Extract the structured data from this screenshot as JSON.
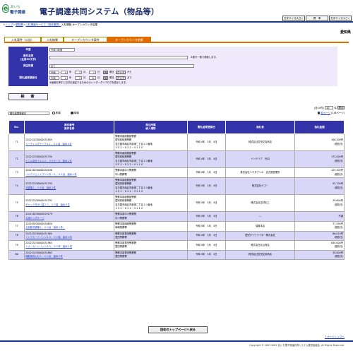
{
  "header": {
    "logo_top": "あいち",
    "logo_bottom": "電子調達",
    "title": "電子調達共同システム（物品等）",
    "buttons": [
      "文字サイズ大きく",
      "標　準",
      "文字サイズ小さく"
    ]
  },
  "breadcrumb": {
    "items": [
      "トップ",
      "愛知県",
      "入札情報サービス（団体選択）"
    ],
    "current": "入札情報-オープンカウンタ結果",
    "separators": [
      "＞",
      "＞",
      "＞"
    ]
  },
  "prefecture": "愛知県",
  "tabs": [
    "入札案件（公告）",
    "入札結果",
    "オープンカウンタ案件",
    "オープンカウンタ結果"
  ],
  "form": {
    "fiscal_year_label": "年度",
    "fiscal_year_value": "令和 3年度",
    "case_name_label": "案件名称\n(全角50文字)",
    "case_name_note": "※部分一致で検索します。",
    "dept_label": "発注所属",
    "dept_value": "全て",
    "date_label": "開札結果登録日",
    "era": "令和",
    "from": {
      "year": "4",
      "month": "3",
      "day": "1"
    },
    "to": {
      "year": "4",
      "month": "3",
      "day": "31"
    },
    "unit_year": "年",
    "unit_month": "月",
    "unit_day": "日",
    "weekday_suffix": "曜日",
    "calendar_icon_label": "曆",
    "clear_label": "クリア",
    "from_suffix": "から",
    "to_suffix": "まで",
    "calendar_note": "※画像を押すと日付を指定するためのカレンダーダイアログを表示します。",
    "search_label": "検　索"
  },
  "list_controls": {
    "sort_value": "開札結果登録日",
    "asc_label": "昇順",
    "desc_label": "降順",
    "count_label": "(全10件)",
    "per_page_value": "10",
    "per_page_suffix": "件",
    "display_label": "表示",
    "prev_label": "前ページ",
    "page_info": "(1/8ページ)"
  },
  "table": {
    "headers": [
      "No.",
      "案件番号\n案件名称",
      "発注所属\n納入場所",
      "開札結果登録日",
      "落札者",
      "落札金額"
    ],
    "rows": [
      {
        "no": "71",
        "case_no": "220224230000031805",
        "case_name": "ミーティングテーブル１，００台　始め４件",
        "dept": [
          "警察本部総務部警察",
          "愛知県総務警察",
          "名古屋市南区市部港二丁目２０番地",
          "０５２－８２２－０１１０"
        ],
        "date": "令和 4年　3月　4日",
        "winner": "株式会社富田文具商店",
        "amount": "106,208円",
        "tax": "(税抜き)"
      },
      {
        "no": "72",
        "case_no": "220222230000031794",
        "case_name": "ビニル床タイル２０，００ケース　始め１件",
        "dept": [
          "警察本部総務部警察",
          "愛知県総務警察",
          "名古屋市南区市部港二丁目２０番地",
          "０５２－８２２－０１１０"
        ],
        "date": "令和 4年　3月　4日",
        "winner": "インテリア　丹羽",
        "amount": "172,000円",
        "tax": "(税抜き)"
      },
      {
        "no": "73",
        "case_no": "220228230000032036",
        "case_name": "インクジェットプリンター５，００台　始め１件",
        "dept": [
          "警察本部中川警察署",
          "中川警察署"
        ],
        "date": "令和 4年　3月　4日",
        "winner": "株式会社ヤマダデンキ　名古屋営業所",
        "amount": "125,300円",
        "tax": "(税抜き)"
      },
      {
        "no": "74",
        "case_no": "220222230000031793",
        "case_name": "洗濯機１，００台　始め２件",
        "dept": [
          "警察本部総務部警察",
          "愛知県総務警察",
          "名古屋市南区市部港二丁目２０番地",
          "０５２－８２２－０１１０"
        ],
        "date": "令和 4年　3月　4日",
        "winner": "株式会社ナゴー",
        "amount": "92,700円",
        "tax": "(税抜き)"
      },
      {
        "no": "75",
        "case_no": "220222230000031791",
        "case_name": "チャック付ポリ袋２０，００袋　始め５件",
        "dept": [
          "警察本部総務部警察",
          "愛知県総務警察",
          "名古屋市南区市部港二丁目２０番地",
          "０５２－８２２－０１１０"
        ],
        "date": "令和 4年　3月　4日",
        "winner": "株式会社吉村化工",
        "amount": "39,600円",
        "tax": "(税抜き)"
      },
      {
        "no": "76",
        "case_no": "220218230000029179",
        "case_name": "大用ドッグケージ",
        "dept": [
          "警察本部中川警察署",
          "中川警察署"
        ],
        "date": "令和 4年　3月　4日",
        "winner": "―",
        "amount": "不調",
        "tax": ""
      },
      {
        "no": "77",
        "case_no": "220209230000030654",
        "case_name": "全自動洗濯機１，００台　始め１件。",
        "dept": [
          "警察本部岡崎警察署",
          "岡崎警察署"
        ],
        "date": "令和 4年　3月　4日",
        "winner": "須藤本店",
        "amount": "37,590円",
        "tax": "(税抜き)"
      },
      {
        "no": "78",
        "case_no": "220225230000031964",
        "case_name": "インクカートリッジ１０，００個　始め４件",
        "dept": [
          "警察本部豊田警察署",
          "豊田警察署"
        ],
        "date": "令和 4年　3月　4日",
        "winner": "愛知ダイワライター株式会社",
        "amount": "86,018円",
        "tax": "(税抜き)"
      },
      {
        "no": "79",
        "case_no": "220225230000031963",
        "case_name": "トナーカートリッジ２０，００本　始め２件",
        "dept": [
          "警察本部豊田警察署",
          "豊田警察署"
        ],
        "date": "令和 4年　3月　4日",
        "winner": "株式会社北山商会",
        "amount": "630,000円",
        "tax": "(税抜き)"
      },
      {
        "no": "80",
        "case_no": "220225230000031862",
        "case_name": "機能用具入れ１，００台　始め１件",
        "dept": [
          "警察本部豊田警察署",
          "豊田警察署"
        ],
        "date": "令和 4年　3月　4日",
        "winner": "株式会社富田文具商店",
        "amount": "38,600円",
        "tax": "(税抜き)"
      }
    ]
  },
  "back_button": "団体のトップページへ戻る",
  "page_top": "↑ページトップへ",
  "copyright": "Copyright © 2007-2022 あいち電子調達共同システム運営協議会. All Rights Reserved."
}
